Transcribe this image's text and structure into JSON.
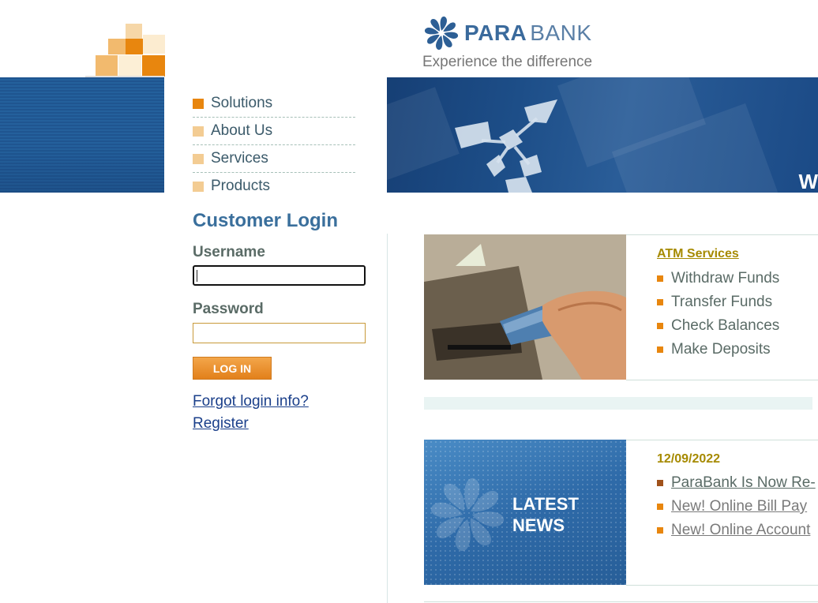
{
  "header": {
    "logo_name": "PARA",
    "logo_bank": "BANK",
    "tagline": "Experience the difference",
    "banner_partial_text": "W"
  },
  "nav": {
    "items": [
      {
        "label": "Solutions"
      },
      {
        "label": "About Us"
      },
      {
        "label": "Services"
      },
      {
        "label": "Products"
      }
    ]
  },
  "login": {
    "title": "Customer Login",
    "username_label": "Username",
    "username_value": "",
    "password_label": "Password",
    "password_value": "",
    "button_label": "LOG IN",
    "forgot_link": "Forgot login info?",
    "register_link": "Register"
  },
  "atm": {
    "title": "ATM Services",
    "items": [
      "Withdraw Funds",
      "Transfer Funds",
      "Check Balances",
      "Make Deposits"
    ]
  },
  "news": {
    "image_text_line1": "LATEST",
    "image_text_line2": "NEWS",
    "date": "12/09/2022",
    "items": [
      "ParaBank Is Now Re-",
      "New! Online Bill Pay",
      "New! Online Account"
    ]
  },
  "colors": {
    "brand_blue": "#3a6f9c",
    "accent_orange": "#e8860e",
    "olive": "#a68a00"
  }
}
